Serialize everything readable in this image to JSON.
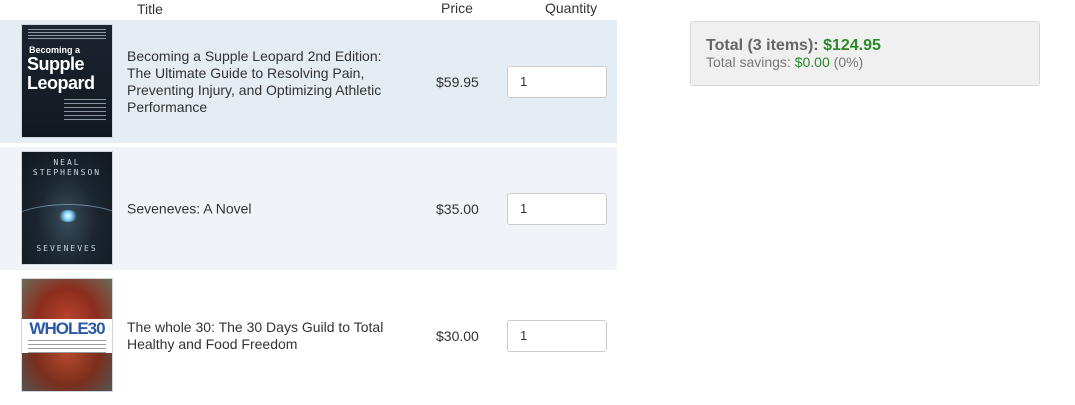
{
  "header": {
    "title_label": "Title",
    "price_label": "Price",
    "quantity_label": "Quantity"
  },
  "items": [
    {
      "title": "Becoming a Supple Leopard 2nd Edition: The Ultimate Guide to Resolving Pain, Preventing Injury, and Optimizing Athletic Performance",
      "price": "$59.95",
      "quantity": "1",
      "cover": {
        "line1": "Becoming a",
        "line2": "Supple",
        "line3": "Leopard"
      }
    },
    {
      "title": "Seveneves: A Novel",
      "price": "$35.00",
      "quantity": "1",
      "cover": {
        "author": "NEAL STEPHENSON",
        "name": "SEVENEVES"
      }
    },
    {
      "title": "The whole 30: The 30 Days Guild to Total Healthy and Food Freedom",
      "price": "$30.00",
      "quantity": "1",
      "cover": {
        "logo": "WHOLE30"
      }
    }
  ],
  "summary": {
    "total_label": "Total (3 items):",
    "total_amount": "$124.95",
    "savings_label": "Total savings:",
    "savings_amount": "$0.00",
    "savings_percent": "(0%)"
  },
  "colors": {
    "accent_green": "#2a8a2a",
    "row_highlight": "#e4ecf4",
    "row_alt": "#f0f4f8"
  }
}
